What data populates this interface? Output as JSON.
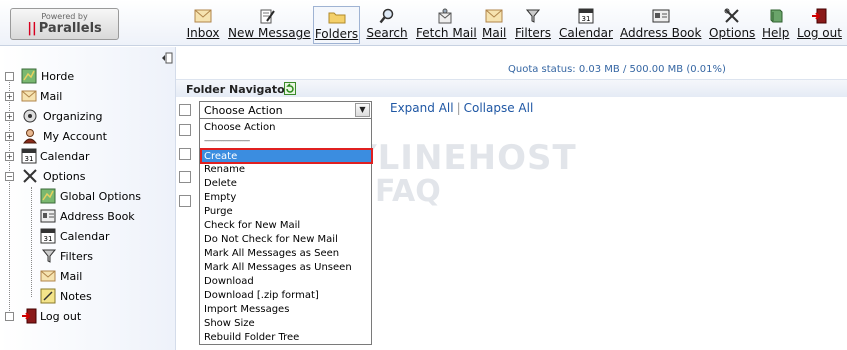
{
  "logo": {
    "powered_by": "Powered by",
    "brand": "Parallels"
  },
  "toolbar": {
    "items": [
      {
        "label": "Inbox",
        "icon": "envelope-icon"
      },
      {
        "label": "New Message",
        "icon": "compose-icon"
      },
      {
        "label": "Folders",
        "icon": "folder-icon",
        "active": true
      },
      {
        "label": "Search",
        "icon": "magnifier-icon"
      },
      {
        "label": "Fetch Mail",
        "icon": "fetch-mail-icon"
      },
      {
        "label": "Mail",
        "icon": "envelope-icon"
      },
      {
        "label": "Filters",
        "icon": "funnel-icon"
      },
      {
        "label": "Calendar",
        "icon": "calendar-icon"
      },
      {
        "label": "Address Book",
        "icon": "address-card-icon"
      },
      {
        "label": "Options",
        "icon": "tools-icon"
      },
      {
        "label": "Help",
        "icon": "book-icon"
      },
      {
        "label": "Log out",
        "icon": "exit-icon"
      }
    ]
  },
  "sidebar": {
    "items": [
      {
        "label": "Horde"
      },
      {
        "label": "Mail"
      },
      {
        "label": "Organizing"
      },
      {
        "label": "My Account"
      },
      {
        "label": "Calendar"
      },
      {
        "label": "Options"
      },
      {
        "label": "Global Options"
      },
      {
        "label": "Address Book"
      },
      {
        "label": "Calendar"
      },
      {
        "label": "Filters"
      },
      {
        "label": "Mail"
      },
      {
        "label": "Notes"
      },
      {
        "label": "Log out"
      }
    ]
  },
  "quota": {
    "text": "Quota status: 0.03 MB / 500.00 MB (0.01%)"
  },
  "panel": {
    "title": "Folder Navigator"
  },
  "action_select": {
    "value": "Choose Action"
  },
  "links": {
    "expand_all": "Expand All",
    "collapse_all": "Collapse All"
  },
  "dropdown": {
    "first": "Choose Action",
    "separator": "------------------------",
    "selected": "Create",
    "items": [
      "Rename",
      "Delete",
      "Empty",
      "Purge",
      "Check for New Mail",
      "Do Not Check for New Mail",
      "Mark All Messages as Seen",
      "Mark All Messages as Unseen",
      "Download",
      "Download [.zip format]",
      "Import Messages",
      "Show Size",
      "Rebuild Folder Tree"
    ]
  },
  "watermark": {
    "line1": "EASYLINEHOST",
    "line2": "FAQ"
  },
  "colors": {
    "link": "#1f57a4",
    "quota": "#3566a3",
    "highlight": "#3b8de0",
    "highlight_border": "#e02020"
  }
}
